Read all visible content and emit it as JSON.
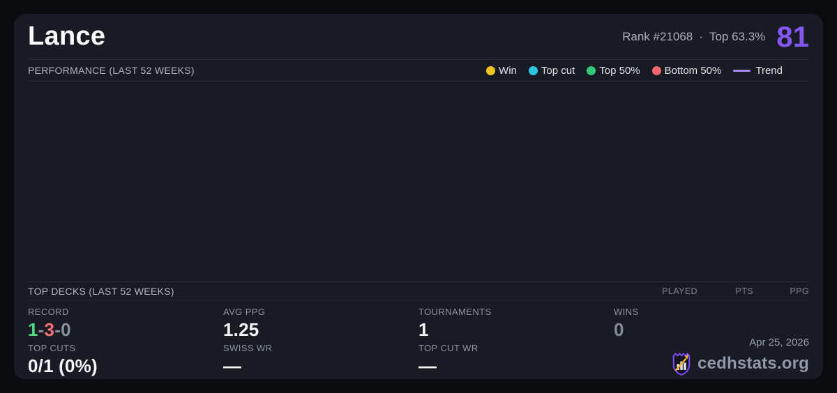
{
  "header": {
    "title": "Lance",
    "rank": "Rank #21068",
    "separator": "·",
    "top_percent": "Top 63.3%",
    "score": "81",
    "score_color": "#8456f0"
  },
  "performance": {
    "section_title": "PERFORMANCE (LAST 52 WEEKS)",
    "legend": [
      {
        "label": "Win",
        "color": "#f0c420"
      },
      {
        "label": "Top cut",
        "color": "#2ec5e5"
      },
      {
        "label": "Top 50%",
        "color": "#34c878"
      },
      {
        "label": "Bottom 50%",
        "color": "#f2646f"
      },
      {
        "label": "Trend",
        "color": "#a78bfa"
      }
    ]
  },
  "chart_data": {
    "type": "scatter",
    "title": "PERFORMANCE (LAST 52 WEEKS)",
    "x": [],
    "series": [],
    "legend_entries": [
      "Win",
      "Top cut",
      "Top 50%",
      "Bottom 50%",
      "Trend"
    ],
    "note": "chart plot area is empty in the screenshot — no points, axes or gridlines rendered"
  },
  "top_decks": {
    "section_title": "TOP DECKS (LAST 52 WEEKS)",
    "columns": [
      "PLAYED",
      "PTS",
      "PPG"
    ],
    "rows": []
  },
  "stats": {
    "record": {
      "label": "RECORD",
      "wins": "1",
      "losses": "3",
      "draws": "0",
      "separator": "-",
      "win_color": "#4ade80",
      "loss_color": "#f47174",
      "draw_color": "#8a919e"
    },
    "avg_ppg": {
      "label": "AVG PPG",
      "value": "1.25"
    },
    "tournaments": {
      "label": "TOURNAMENTS",
      "value": "1"
    },
    "wins": {
      "label": "WINS",
      "value": "0"
    },
    "top_cuts": {
      "label": "TOP CUTS",
      "value": "0/1 (0%)"
    },
    "swiss_wr": {
      "label": "SWISS WR",
      "value": "—"
    },
    "top_cut_wr": {
      "label": "TOP CUT WR",
      "value": "—"
    }
  },
  "branding": {
    "date": "Apr 25, 2026",
    "site_name": "cedhstats.org"
  }
}
